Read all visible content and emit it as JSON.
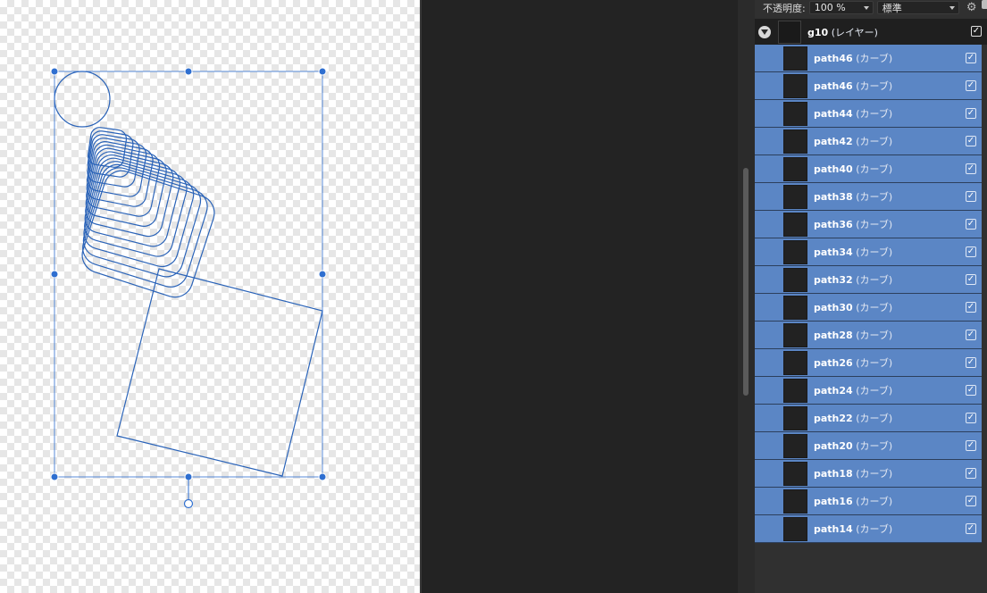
{
  "toolbar": {
    "opacity_label": "不透明度:",
    "opacity_value": "100 %",
    "blend_mode": "標準",
    "settings_icon": "gear-icon"
  },
  "group": {
    "name": "g10",
    "kind": "(レイヤー)",
    "visible": true
  },
  "layers": [
    {
      "name": "path46",
      "kind": "(カーブ)",
      "visible": true
    },
    {
      "name": "path46",
      "kind": "(カーブ)",
      "visible": true
    },
    {
      "name": "path44",
      "kind": "(カーブ)",
      "visible": true
    },
    {
      "name": "path42",
      "kind": "(カーブ)",
      "visible": true
    },
    {
      "name": "path40",
      "kind": "(カーブ)",
      "visible": true
    },
    {
      "name": "path38",
      "kind": "(カーブ)",
      "visible": true
    },
    {
      "name": "path36",
      "kind": "(カーブ)",
      "visible": true
    },
    {
      "name": "path34",
      "kind": "(カーブ)",
      "visible": true
    },
    {
      "name": "path32",
      "kind": "(カーブ)",
      "visible": true
    },
    {
      "name": "path30",
      "kind": "(カーブ)",
      "visible": true
    },
    {
      "name": "path28",
      "kind": "(カーブ)",
      "visible": true
    },
    {
      "name": "path26",
      "kind": "(カーブ)",
      "visible": true
    },
    {
      "name": "path24",
      "kind": "(カーブ)",
      "visible": true
    },
    {
      "name": "path22",
      "kind": "(カーブ)",
      "visible": true
    },
    {
      "name": "path20",
      "kind": "(カーブ)",
      "visible": true
    },
    {
      "name": "path18",
      "kind": "(カーブ)",
      "visible": true
    },
    {
      "name": "path16",
      "kind": "(カーブ)",
      "visible": true
    },
    {
      "name": "path14",
      "kind": "(カーブ)",
      "visible": true
    }
  ],
  "colors": {
    "selection": "#2f6fd0",
    "stroke": "#2a63b8",
    "selected_row": "#5b86c5"
  }
}
